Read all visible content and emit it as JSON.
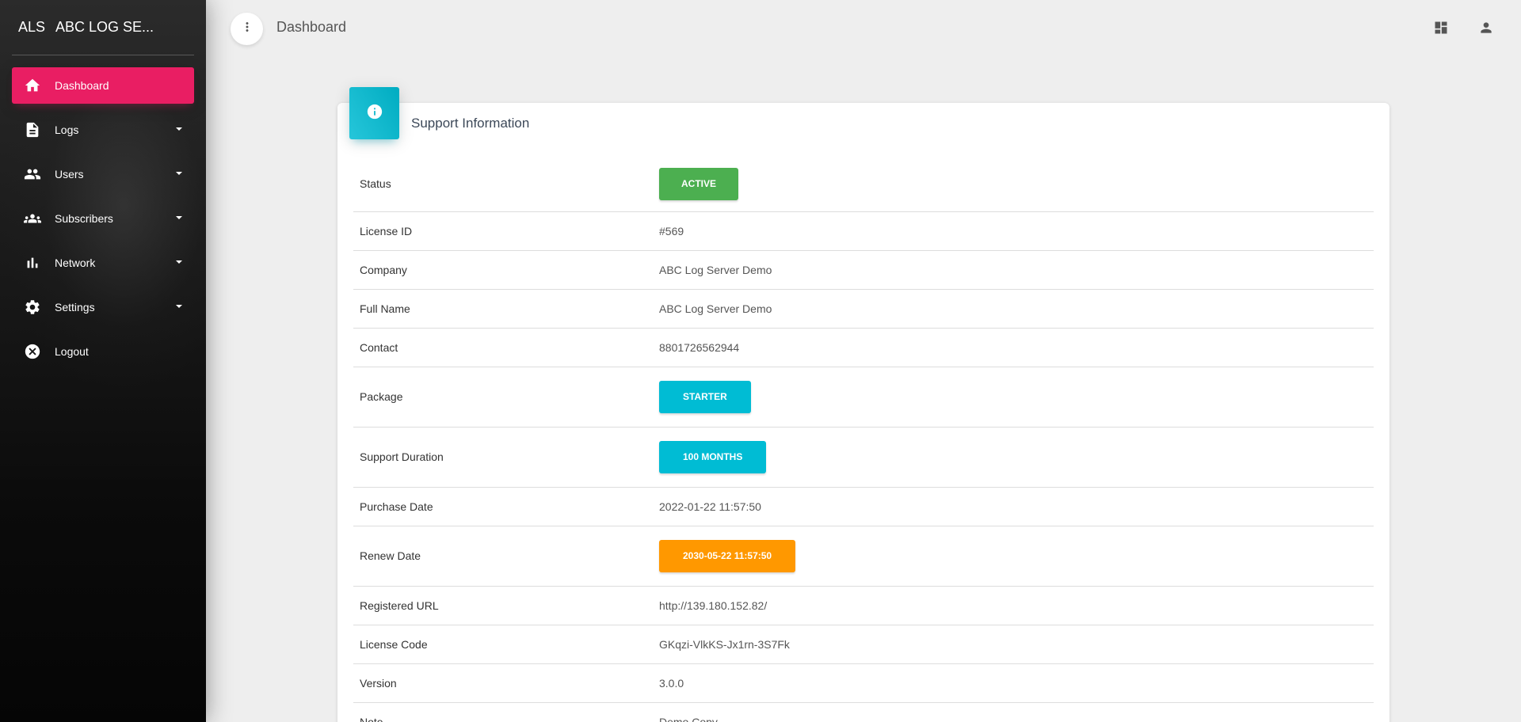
{
  "brand": {
    "mini": "ALS",
    "name": "ABC LOG SE..."
  },
  "sidebar": {
    "items": [
      {
        "label": "Dashboard",
        "icon": "home-icon",
        "active": true
      },
      {
        "label": "Logs",
        "icon": "document-icon",
        "caret": true
      },
      {
        "label": "Users",
        "icon": "people-icon",
        "caret": true
      },
      {
        "label": "Subscribers",
        "icon": "groups-icon",
        "caret": true
      },
      {
        "label": "Network",
        "icon": "bar-chart-icon",
        "caret": true
      },
      {
        "label": "Settings",
        "icon": "gear-icon",
        "caret": true
      },
      {
        "label": "Logout",
        "icon": "cancel-icon"
      }
    ]
  },
  "header": {
    "title": "Dashboard"
  },
  "card": {
    "title": "Support Information",
    "rows": [
      {
        "label": "Status",
        "value": "ACTIVE",
        "badge": "green"
      },
      {
        "label": "License ID",
        "value": "#569"
      },
      {
        "label": "Company",
        "value": "ABC Log Server Demo"
      },
      {
        "label": "Full Name",
        "value": "ABC Log Server Demo"
      },
      {
        "label": "Contact",
        "value": "8801726562944"
      },
      {
        "label": "Package",
        "value": "STARTER",
        "badge": "cyan"
      },
      {
        "label": "Support Duration",
        "value": "100 MONTHS",
        "badge": "cyan"
      },
      {
        "label": "Purchase Date",
        "value": "2022-01-22 11:57:50"
      },
      {
        "label": "Renew Date",
        "value": "2030-05-22 11:57:50",
        "badge": "orange"
      },
      {
        "label": "Registered URL",
        "value": "http://139.180.152.82/"
      },
      {
        "label": "License Code",
        "value": "GKqzi-VlkKS-Jx1rn-3S7Fk"
      },
      {
        "label": "Version",
        "value": "3.0.0"
      },
      {
        "label": "Note",
        "value": "Demo Copy"
      }
    ]
  },
  "colors": {
    "active": "#e91e63",
    "green": "#4caf50",
    "cyan": "#00bcd4",
    "orange": "#ff9800"
  }
}
